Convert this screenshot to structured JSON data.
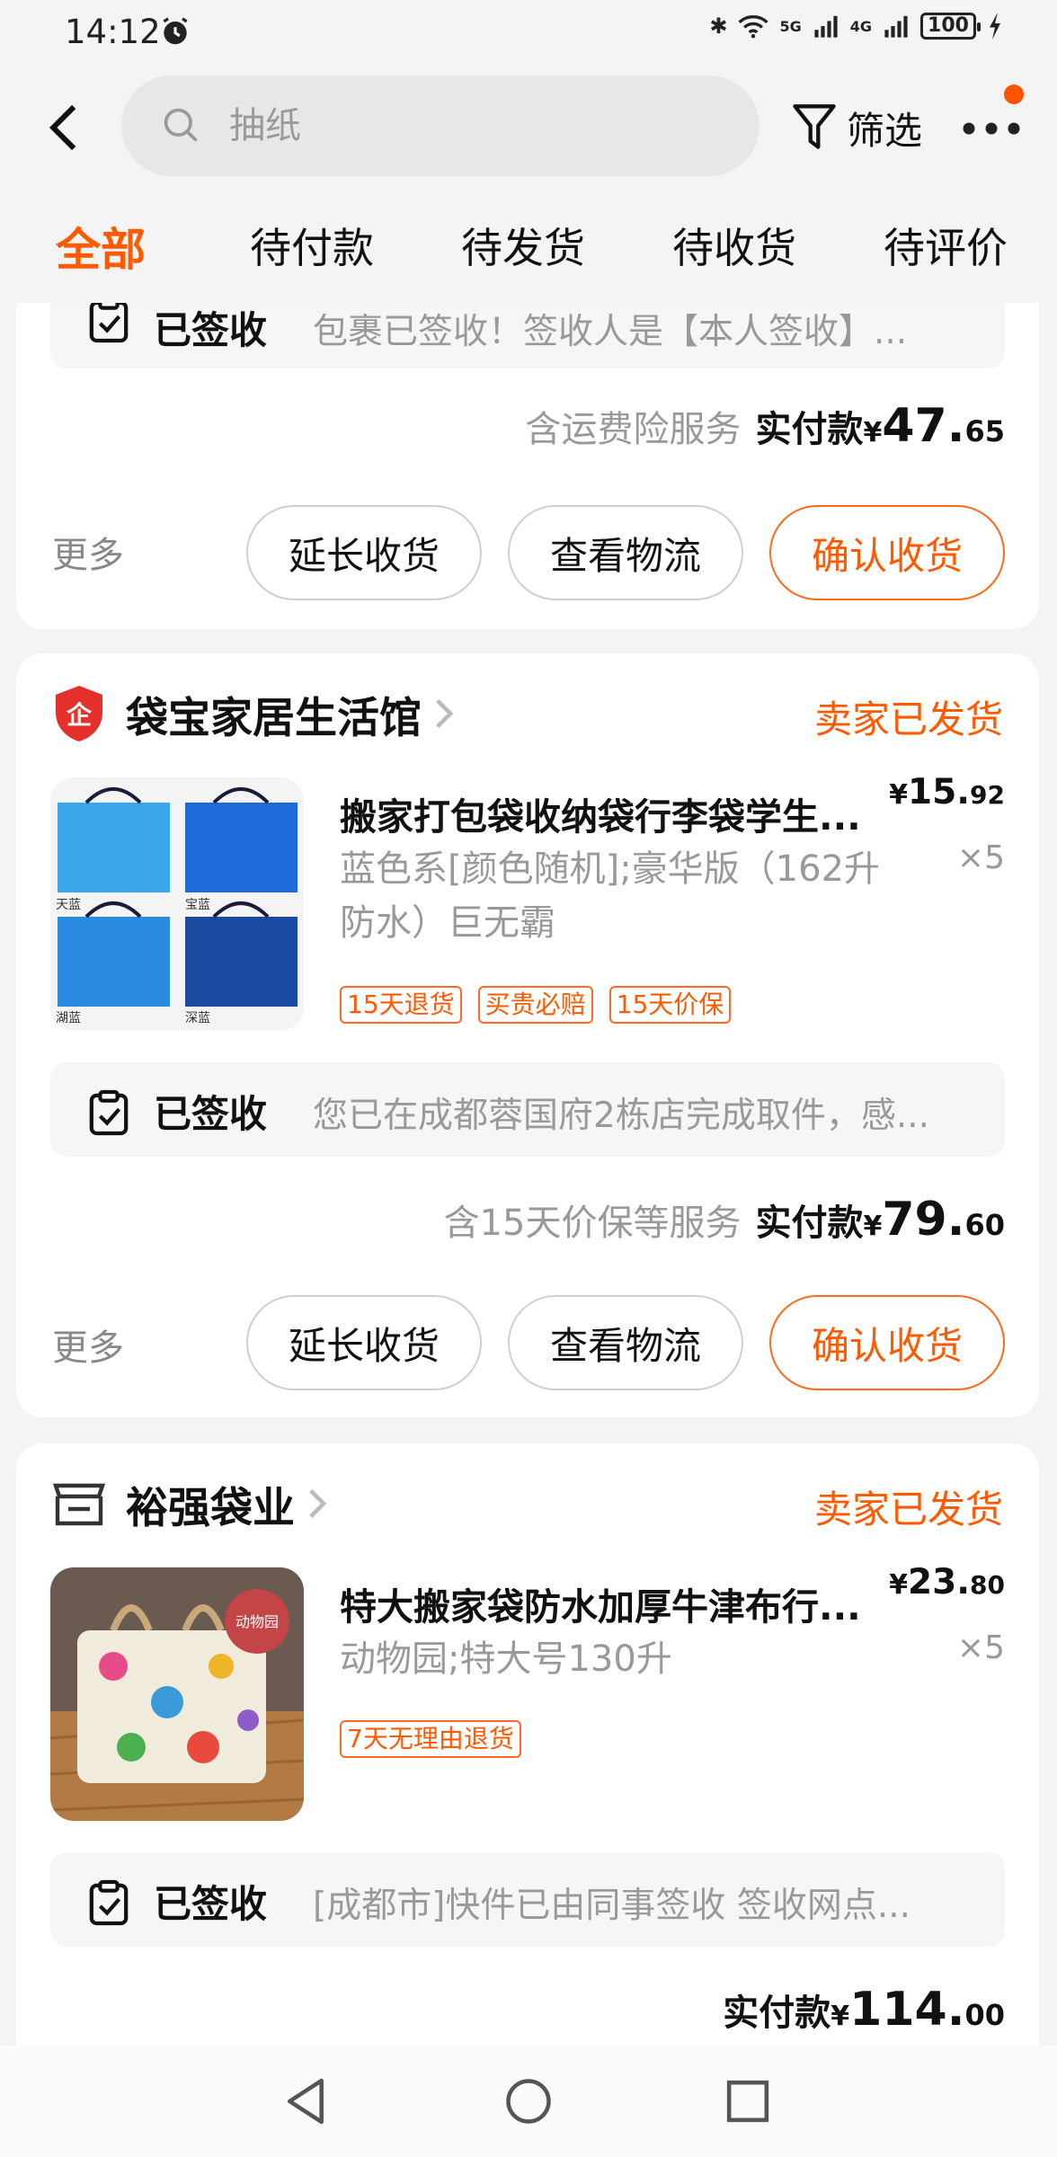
{
  "status_bar": {
    "time": "14:12",
    "network_1": "5G",
    "network_2": "4G",
    "battery": "100"
  },
  "header": {
    "search_placeholder": "抽纸",
    "filter_label": "筛选"
  },
  "tabs": [
    {
      "label": "全部",
      "active": true
    },
    {
      "label": "待付款"
    },
    {
      "label": "待发货"
    },
    {
      "label": "待收货"
    },
    {
      "label": "待评价"
    }
  ],
  "orders": [
    {
      "logistics_state": "已签收",
      "logistics_detail": "包裹已签收！签收人是【本人签收】...",
      "service_note": "含运费险服务",
      "paid_label": "实付款",
      "currency": "¥",
      "paid_int": "47.",
      "paid_dec": "65",
      "more_label": "更多",
      "buttons": [
        "延长收货",
        "查看物流",
        "确认收货"
      ]
    },
    {
      "store_name": "袋宝家居生活馆",
      "ship_status": "卖家已发货",
      "item": {
        "title": "搬家打包袋收纳袋行李袋学生...",
        "sku": "蓝色系[颜色随机];豪华版（162升防水）巨无霸",
        "price_int": "15.",
        "price_dec": "92",
        "qty": "×5",
        "tags": [
          "15天退货",
          "买贵必赔",
          "15天价保"
        ],
        "thumb_labels": [
          "天蓝",
          "宝蓝",
          "湖蓝",
          "深蓝"
        ]
      },
      "logistics_state": "已签收",
      "logistics_detail": "您已在成都蓉国府2栋店完成取件，感...",
      "service_note": "含15天价保等服务",
      "paid_label": "实付款",
      "currency": "¥",
      "paid_int": "79.",
      "paid_dec": "60",
      "more_label": "更多",
      "buttons": [
        "延长收货",
        "查看物流",
        "确认收货"
      ]
    },
    {
      "store_name": "裕强袋业",
      "ship_status": "卖家已发货",
      "item": {
        "title": "特大搬家袋防水加厚牛津布行...",
        "sku": "动物园;特大号130升",
        "price_int": "23.",
        "price_dec": "80",
        "qty": "×5",
        "tags": [
          "7天无理由退货"
        ],
        "thumb_badge": "动物园"
      },
      "logistics_state": "已签收",
      "logistics_detail": "[成都市]快件已由同事签收 签收网点...",
      "paid_label": "实付款",
      "currency": "¥",
      "paid_int": "114.",
      "paid_dec": "00"
    }
  ],
  "colors": {
    "accent": "#ff5a00",
    "background": "#f4f4f4",
    "card": "#ffffff",
    "muted_text": "#999999"
  }
}
